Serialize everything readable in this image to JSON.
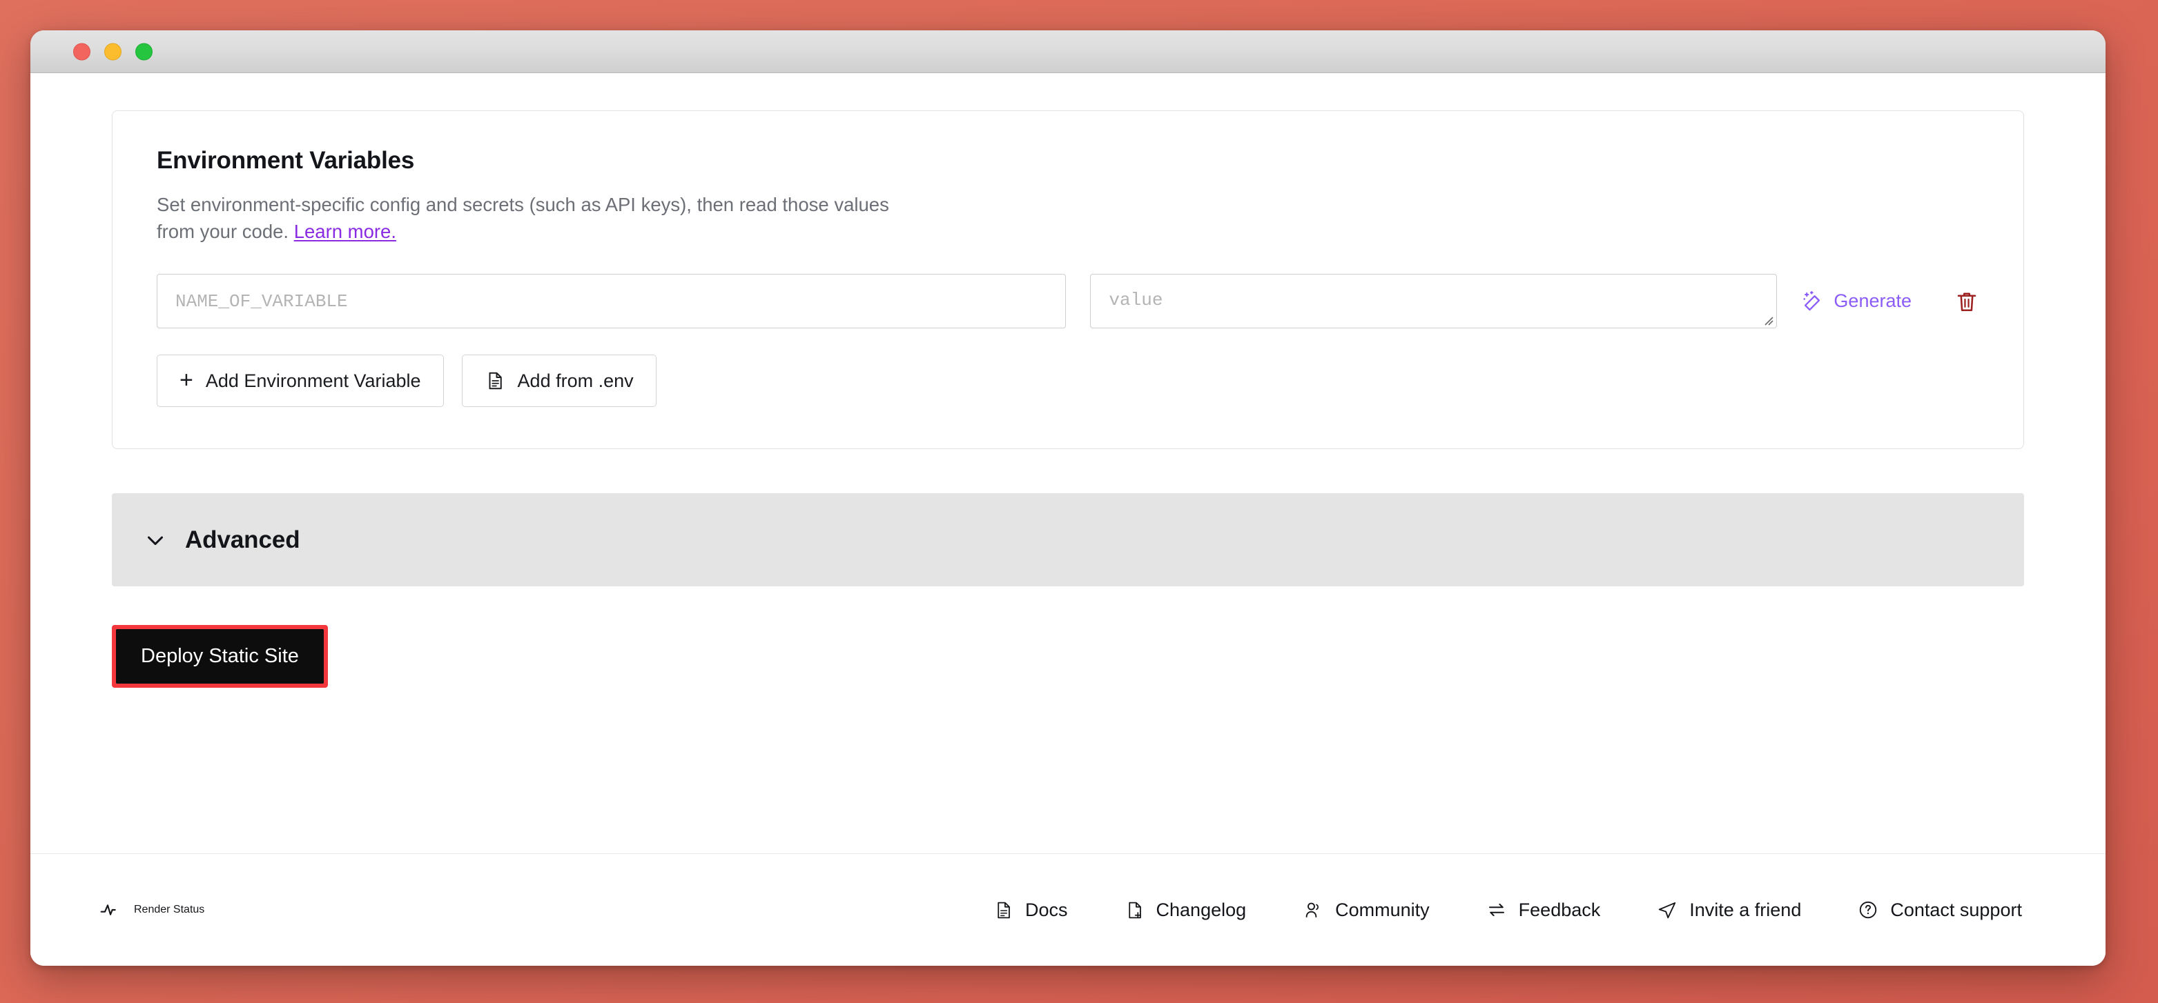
{
  "window": {
    "traffic_lights": [
      {
        "name": "close",
        "color": "#f2655f"
      },
      {
        "name": "minimize",
        "color": "#fbbd2e"
      },
      {
        "name": "maximize",
        "color": "#25c53f"
      }
    ]
  },
  "env_card": {
    "title": "Environment Variables",
    "description_part1": "Set environment-specific config and secrets (such as API keys), then read those values from your code.",
    "learn_more_label": "Learn more.",
    "learn_more_color": "#8a2be2",
    "name_input": {
      "value": "",
      "placeholder": "NAME_OF_VARIABLE"
    },
    "value_input": {
      "value": "",
      "placeholder": "value"
    },
    "generate_label": "Generate",
    "generate_color": "#8b5cf6",
    "generate_icon": "magic-wand-icon",
    "delete_icon": "trash-icon",
    "delete_color": "#9e2121",
    "add_variable_label": "Add Environment Variable",
    "add_variable_icon": "plus-icon",
    "add_from_env_label": "Add from .env",
    "add_from_env_icon": "file-text-icon"
  },
  "advanced": {
    "label": "Advanced",
    "chevron_icon": "chevron-down-icon",
    "background": "#e4e4e4",
    "expanded": false
  },
  "deploy": {
    "label": "Deploy Static Site",
    "background": "#0d0d0d",
    "text_color": "#ffffff",
    "highlight_color": "#f4373d"
  },
  "footer": {
    "status": {
      "label": "Render Status",
      "icon": "activity-pulse-icon"
    },
    "links": [
      {
        "label": "Docs",
        "icon": "file-text-icon"
      },
      {
        "label": "Changelog",
        "icon": "file-plus-icon"
      },
      {
        "label": "Community",
        "icon": "users-icon"
      },
      {
        "label": "Feedback",
        "icon": "arrows-exchange-icon"
      },
      {
        "label": "Invite a friend",
        "icon": "send-icon"
      },
      {
        "label": "Contact support",
        "icon": "help-circle-icon"
      }
    ]
  }
}
